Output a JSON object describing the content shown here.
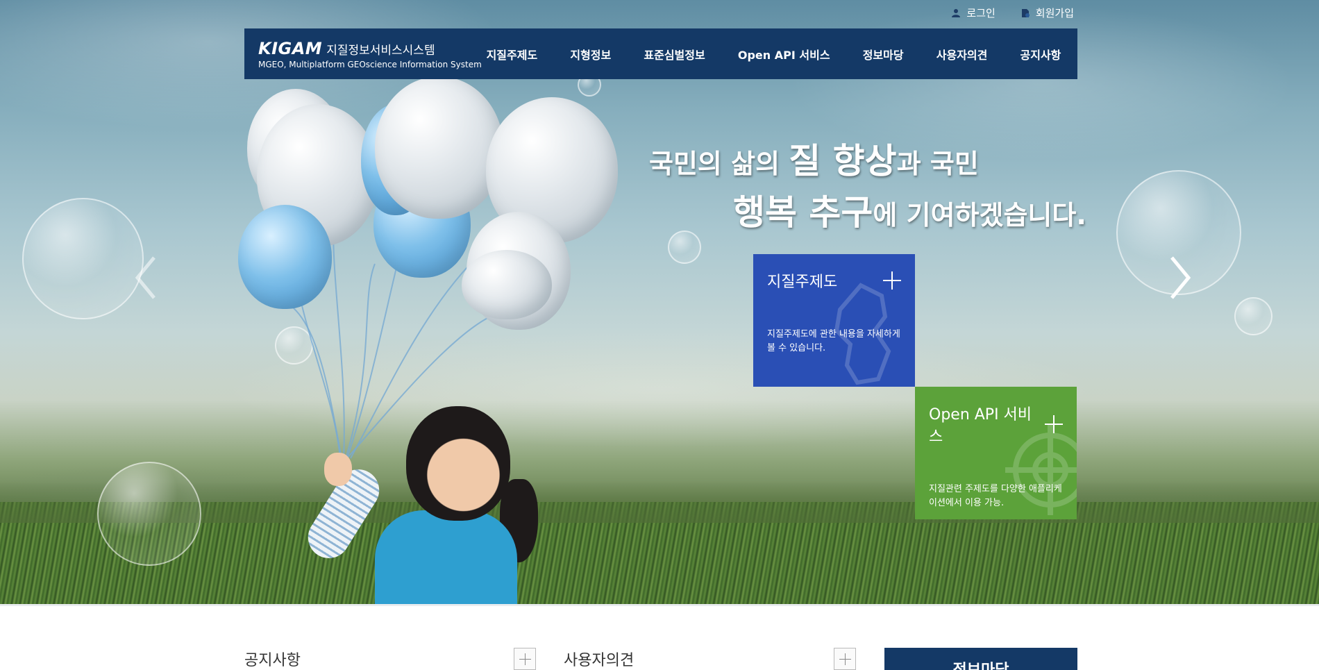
{
  "util_links": {
    "login": "로그인",
    "signup": "회원가입"
  },
  "brand": {
    "logo": "KIGAM",
    "title": "지질정보서비스시스템",
    "subtitle": "MGEO, Multiplatform GEOscience Information System"
  },
  "nav": {
    "items": [
      {
        "label": "지질주제도"
      },
      {
        "label": "지형정보"
      },
      {
        "label": "표준심벌정보"
      },
      {
        "label": "Open API 서비스"
      },
      {
        "label": "정보마당"
      },
      {
        "label": "사용자의견"
      },
      {
        "label": "공지사항"
      }
    ]
  },
  "headline": {
    "l1_a": "국민의 삶의 ",
    "l1_b": "질 향상",
    "l1_c": "과 국민",
    "l2_a": "행복 추구",
    "l2_b": "에 기여하겠습니다."
  },
  "features": {
    "geo_map": {
      "title": "지질주제도",
      "desc": "지질주제도에 관한 내용을 자세하게 볼 수 있습니다.",
      "color": "#2a4fb5"
    },
    "open_api": {
      "title": "Open API 서비스",
      "desc": "지질관련 주제도를 다양한 애플리케이션에서 이용 가능.",
      "color": "#5ca23a"
    }
  },
  "bottom": {
    "notice_title": "공지사항",
    "opinion_title": "사용자의견",
    "info_tab": "정보마당"
  },
  "colors": {
    "nav_bg": "#143966",
    "feature_blue": "#2a4fb5",
    "feature_green": "#5ca23a"
  }
}
